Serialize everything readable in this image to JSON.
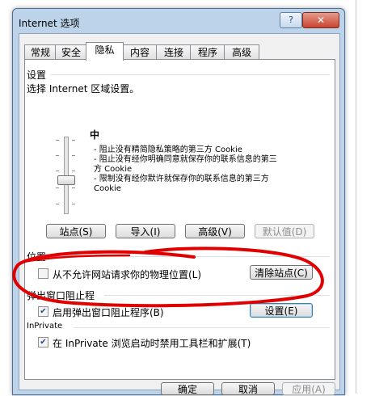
{
  "window": {
    "title": "Internet 选项",
    "help_button": "?",
    "close_button": "✕"
  },
  "tabs": [
    {
      "label": "常规"
    },
    {
      "label": "安全"
    },
    {
      "label": "隐私"
    },
    {
      "label": "内容"
    },
    {
      "label": "连接"
    },
    {
      "label": "程序"
    },
    {
      "label": "高级"
    }
  ],
  "settings": {
    "group_label": "设置",
    "instruction": "选择 Internet 区域设置。",
    "level": "中",
    "descriptions": [
      "- 阻止没有精简隐私策略的第三方 Cookie",
      "- 阻止没有经你明确同意就保存你的联系信息的第三",
      "方 Cookie",
      "- 限制没有经你默许就保存你的联系信息的第三方",
      "Cookie"
    ],
    "buttons": {
      "sites": "站点(S)",
      "import": "导入(I)",
      "advanced": "高级(V)",
      "default": "默认值(D)"
    }
  },
  "location": {
    "group_label": "位置",
    "checkbox_label": "从不允许网站请求你的物理位置(L)",
    "checked": false,
    "clear_button": "清除站点(C)"
  },
  "popup": {
    "group_label": "弹出窗口阻止程",
    "checkbox_label": "启用弹出窗口阻止程序(B)",
    "checked": true,
    "settings_button": "设置(E)"
  },
  "inprivate": {
    "group_label": "InPrivate",
    "checkbox_label": "在 InPrivate 浏览启动时禁用工具栏和扩展(T)",
    "checked": true
  },
  "footer": {
    "ok": "确定",
    "cancel": "取消",
    "apply": "应用(A)"
  },
  "colors": {
    "annotation": "#e00000",
    "frame": "#bcd3ea"
  }
}
